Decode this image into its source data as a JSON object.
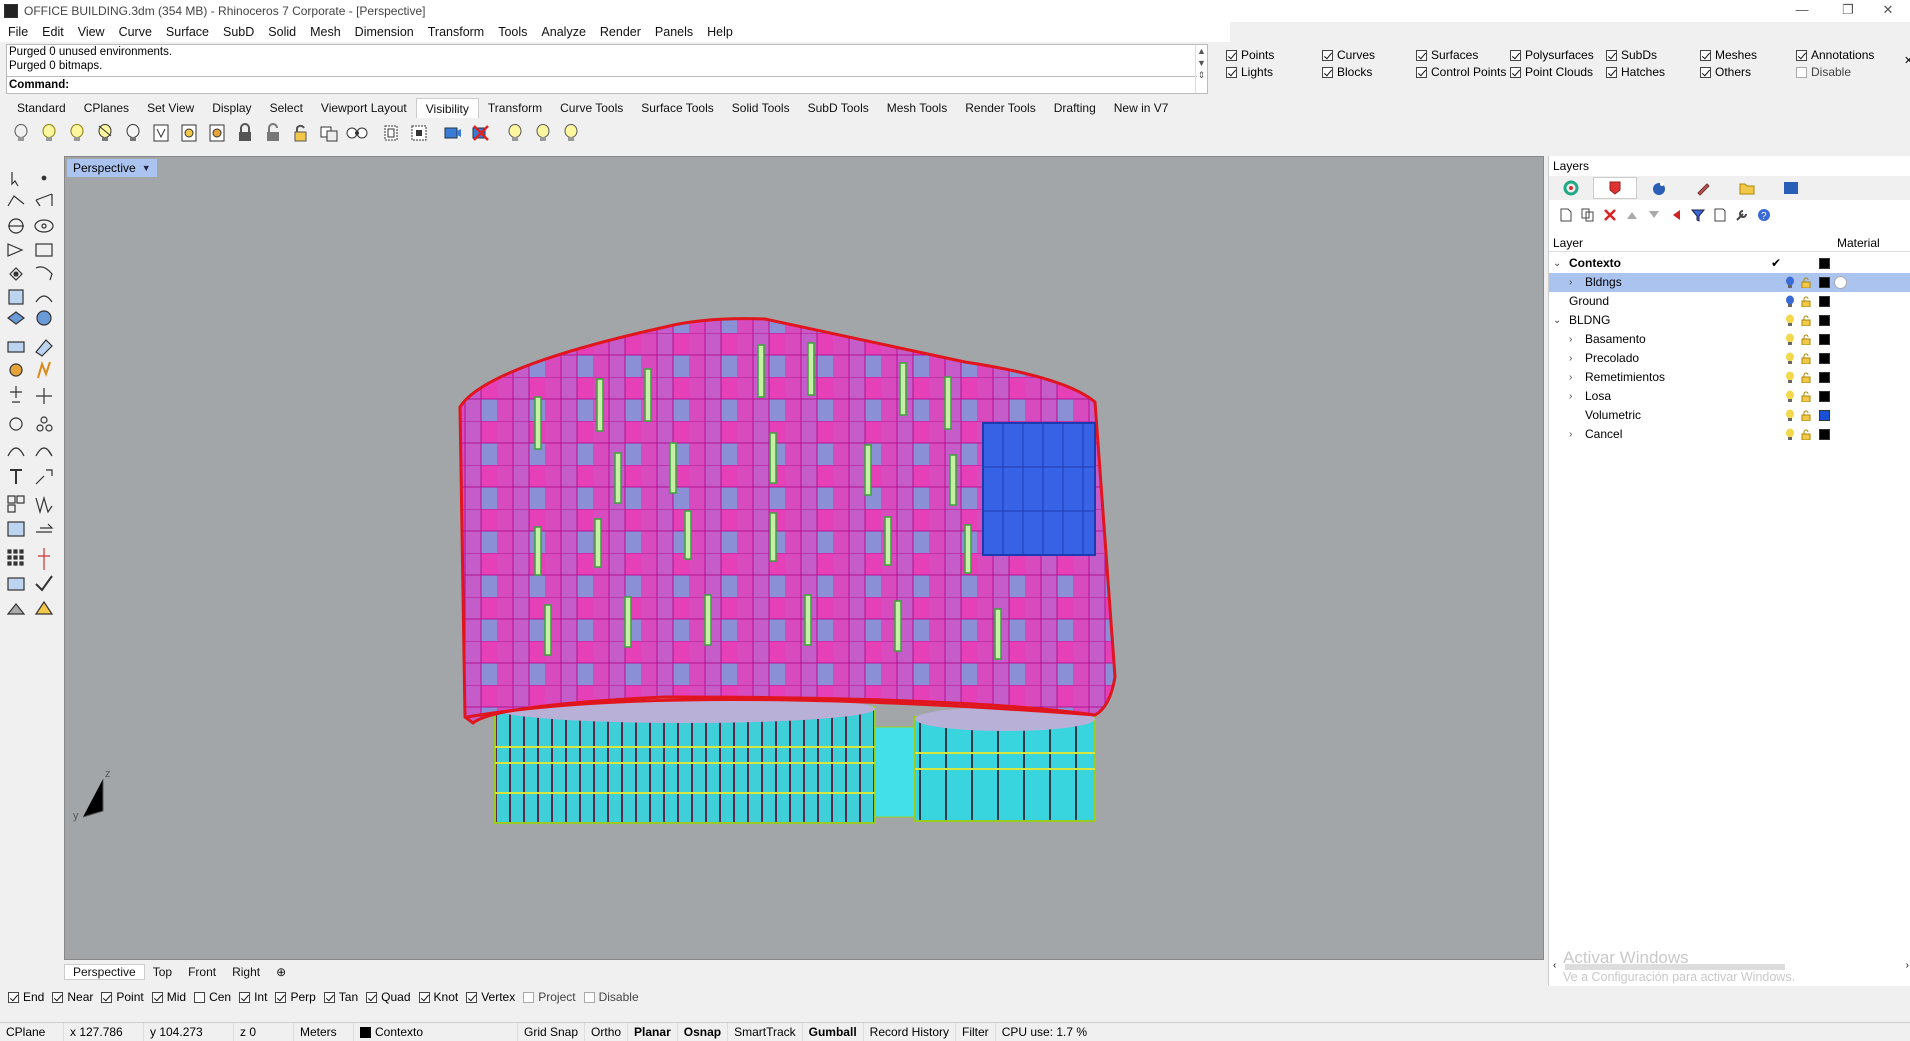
{
  "window": {
    "title": "OFFICE BUILDING.3dm (354 MB) - Rhinoceros 7 Corporate - [Perspective]",
    "minimize": "—",
    "restore": "❐",
    "close": "✕"
  },
  "menu": [
    "File",
    "Edit",
    "View",
    "Curve",
    "Surface",
    "SubD",
    "Solid",
    "Mesh",
    "Dimension",
    "Transform",
    "Tools",
    "Analyze",
    "Render",
    "Panels",
    "Help"
  ],
  "command": {
    "history_1": "Purged 0 unused environments.",
    "history_2": "Purged 0 bitmaps.",
    "prompt": "Command:"
  },
  "visibility": [
    {
      "label": "Points",
      "checked": true
    },
    {
      "label": "Curves",
      "checked": true
    },
    {
      "label": "Surfaces",
      "checked": true
    },
    {
      "label": "Polysurfaces",
      "checked": true
    },
    {
      "label": "SubDs",
      "checked": true
    },
    {
      "label": "Meshes",
      "checked": true
    },
    {
      "label": "Annotations",
      "checked": true
    },
    {
      "label": "Lights",
      "checked": true
    },
    {
      "label": "Blocks",
      "checked": true
    },
    {
      "label": "Control Points",
      "checked": true
    },
    {
      "label": "Point Clouds",
      "checked": true
    },
    {
      "label": "Hatches",
      "checked": true
    },
    {
      "label": "Others",
      "checked": true
    },
    {
      "label": "Disable",
      "checked": false
    }
  ],
  "toolbar_tabs": [
    "Standard",
    "CPlanes",
    "Set View",
    "Display",
    "Select",
    "Viewport Layout",
    "Visibility",
    "Transform",
    "Curve Tools",
    "Surface Tools",
    "Solid Tools",
    "SubD Tools",
    "Mesh Tools",
    "Render Tools",
    "Drafting",
    "New in V7"
  ],
  "active_toolbar_tab": "Visibility",
  "viewport": {
    "label": "Perspective",
    "axis_z": "z",
    "axis_y": "y"
  },
  "viewport_tabs": [
    "Perspective",
    "Top",
    "Front",
    "Right",
    "⊕"
  ],
  "osnaps": [
    {
      "label": "End",
      "checked": true
    },
    {
      "label": "Near",
      "checked": true
    },
    {
      "label": "Point",
      "checked": true
    },
    {
      "label": "Mid",
      "checked": true
    },
    {
      "label": "Cen",
      "checked": false
    },
    {
      "label": "Int",
      "checked": true
    },
    {
      "label": "Perp",
      "checked": true
    },
    {
      "label": "Tan",
      "checked": true
    },
    {
      "label": "Quad",
      "checked": true
    },
    {
      "label": "Knot",
      "checked": true
    },
    {
      "label": "Vertex",
      "checked": true
    },
    {
      "label": "Project",
      "checked": false
    },
    {
      "label": "Disable",
      "checked": false
    }
  ],
  "status": {
    "cplane": "CPlane",
    "x": "x 127.786",
    "y": "y 104.273",
    "z": "z 0",
    "units": "Meters",
    "layer": "Contexto",
    "grid_snap": "Grid Snap",
    "ortho": "Ortho",
    "planar": "Planar",
    "osnap": "Osnap",
    "smarttrack": "SmartTrack",
    "gumball": "Gumball",
    "record_history": "Record History",
    "filter": "Filter",
    "cpu": "CPU use: 1.7 %"
  },
  "layers_panel": {
    "title": "Layers",
    "col_layer": "Layer",
    "col_material": "Material",
    "rows": [
      {
        "name": "Contexto",
        "level": 0,
        "expander": "⌄",
        "bold": true,
        "current": true,
        "color": "#000000"
      },
      {
        "name": "Bldngs",
        "level": 1,
        "expander": "›",
        "selected": true,
        "color": "#000000"
      },
      {
        "name": "Ground",
        "level": 0,
        "expander": "",
        "color": "#000000"
      },
      {
        "name": "BLDNG",
        "level": 0,
        "expander": "⌄",
        "color": "#000000"
      },
      {
        "name": "Basamento",
        "level": 1,
        "expander": "›",
        "color": "#000000"
      },
      {
        "name": "Precolado",
        "level": 1,
        "expander": "›",
        "color": "#000000"
      },
      {
        "name": "Remetimientos",
        "level": 1,
        "expander": "›",
        "color": "#000000"
      },
      {
        "name": "Losa",
        "level": 1,
        "expander": "›",
        "color": "#000000"
      },
      {
        "name": "Volumetric",
        "level": 1,
        "expander": "",
        "color": "#1a4fd8"
      },
      {
        "name": "Cancel",
        "level": 1,
        "expander": "›",
        "color": "#000000"
      }
    ],
    "watermark_title": "Activar Windows",
    "watermark_sub": "Ve a Configuración para activar Windows."
  }
}
